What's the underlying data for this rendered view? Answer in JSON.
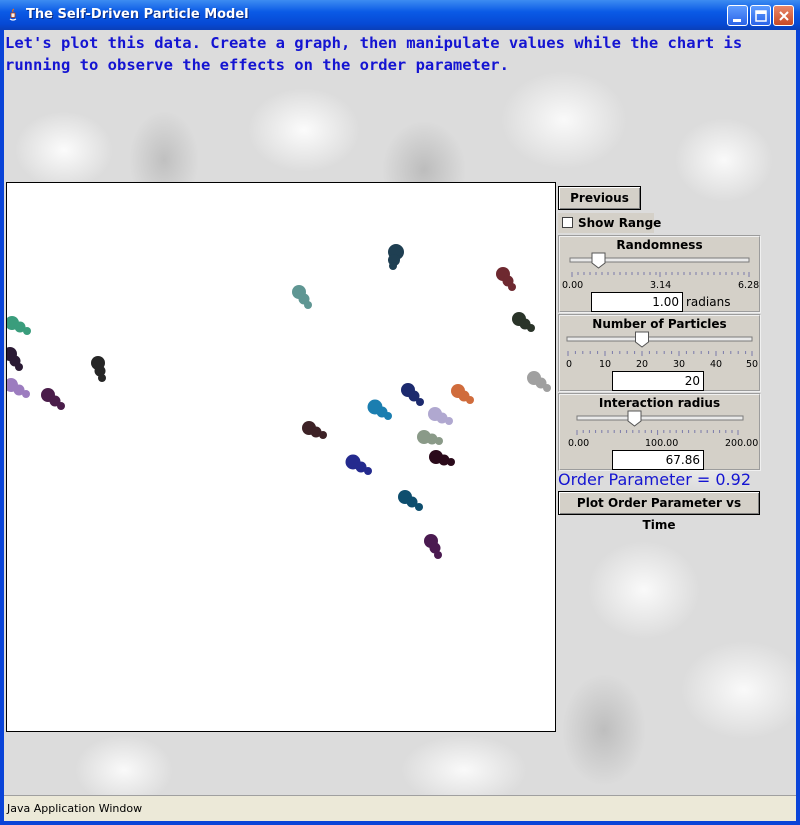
{
  "window": {
    "title": "The Self-Driven Particle Model",
    "status_text": "Java Application Window"
  },
  "instructions": "Let's plot this data.  Create a graph, then manipulate values while the chart is running to observe the effects on the order parameter.",
  "controls": {
    "previous_label": "Previous",
    "show_range_label": "Show Range",
    "show_range_checked": false,
    "randomness": {
      "title": "Randomness",
      "ticks": [
        "0.00",
        "3.14",
        "6.28"
      ],
      "value": "1.00",
      "unit": "radians",
      "fraction": 0.16
    },
    "particles": {
      "title": "Number of Particles",
      "ticks": [
        "0",
        "10",
        "20",
        "30",
        "40",
        "50"
      ],
      "value": "20",
      "fraction": 0.4
    },
    "radius": {
      "title": "Interaction radius",
      "ticks": [
        "0.00",
        "100.00",
        "200.00"
      ],
      "value": "67.86",
      "fraction": 0.34
    },
    "order_parameter": "Order Parameter = 0.92",
    "plot_label": "Plot Order Parameter vs Time"
  },
  "colors": {
    "title_text": "#ffffff",
    "instructions": "#1414d2",
    "order_parameter": "#1414d2"
  }
}
